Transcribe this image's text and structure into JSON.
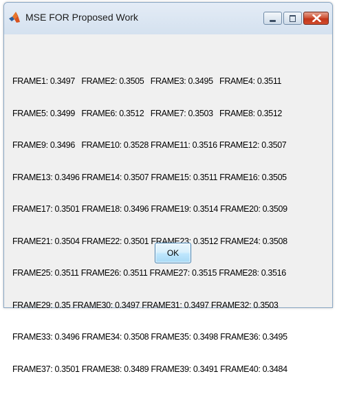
{
  "window": {
    "title": "MSE FOR Proposed Work",
    "icon": "matlab-logo-icon"
  },
  "results": {
    "lines": [
      "FRAME1: 0.3497   FRAME2: 0.3505   FRAME3: 0.3495   FRAME4: 0.3511",
      "FRAME5: 0.3499   FRAME6: 0.3512   FRAME7: 0.3503   FRAME8: 0.3512",
      "FRAME9: 0.3496   FRAME10: 0.3528 FRAME11: 0.3516 FRAME12: 0.3507",
      "FRAME13: 0.3496 FRAME14: 0.3507 FRAME15: 0.3511 FRAME16: 0.3505",
      "FRAME17: 0.3501 FRAME18: 0.3496 FRAME19: 0.3514 FRAME20: 0.3509",
      "FRAME21: 0.3504 FRAME22: 0.3501 FRAME23: 0.3512 FRAME24: 0.3508",
      "FRAME25: 0.3511 FRAME26: 0.3511 FRAME27: 0.3515 FRAME28: 0.3516",
      "FRAME29: 0.35 FRAME30: 0.3497 FRAME31: 0.3497 FRAME32: 0.3503",
      "FRAME33: 0.3496 FRAME34: 0.3508 FRAME35: 0.3498 FRAME36: 0.3495",
      "FRAME37: 0.3501 FRAME38: 0.3489 FRAME39: 0.3491 FRAME40: 0.3484"
    ]
  },
  "buttons": {
    "ok_label": "OK"
  },
  "colors": {
    "close_button": "#c3361a",
    "dialog_background": "#f0f0f0",
    "titlebar": "#dce7f3"
  }
}
